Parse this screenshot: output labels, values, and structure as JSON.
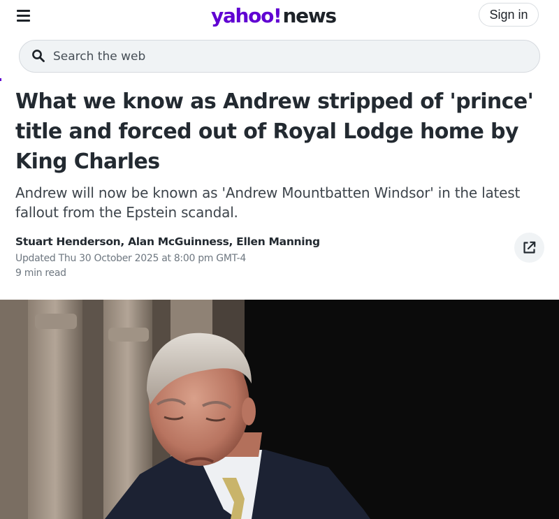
{
  "header": {
    "menu_icon": "hamburger-menu-icon",
    "logo_part1": "yahoo!",
    "logo_part2": "news",
    "signin_label": "Sign in"
  },
  "search": {
    "icon": "search-icon",
    "placeholder": "Search the web",
    "value": ""
  },
  "article": {
    "headline": "What we know as Andrew stripped of 'prince' title and forced out of Royal Lodge home by King Charles",
    "subheadline": "Andrew will now be known as 'Andrew Mountbatten Windsor' in the latest fallout from the Epstein scandal.",
    "authors": "Stuart Henderson, Alan McGuinness, Ellen Manning",
    "updated": "Updated Thu 30 October 2025 at 8:00 pm GMT-4",
    "read_time": "9 min read",
    "share_icon": "share-external-icon",
    "hero_image": "article-hero-photo"
  },
  "colors": {
    "brand_purple": "#6001d2",
    "text_primary": "#232a31",
    "text_secondary": "#6e7780",
    "search_bg": "#f0f3f5"
  }
}
